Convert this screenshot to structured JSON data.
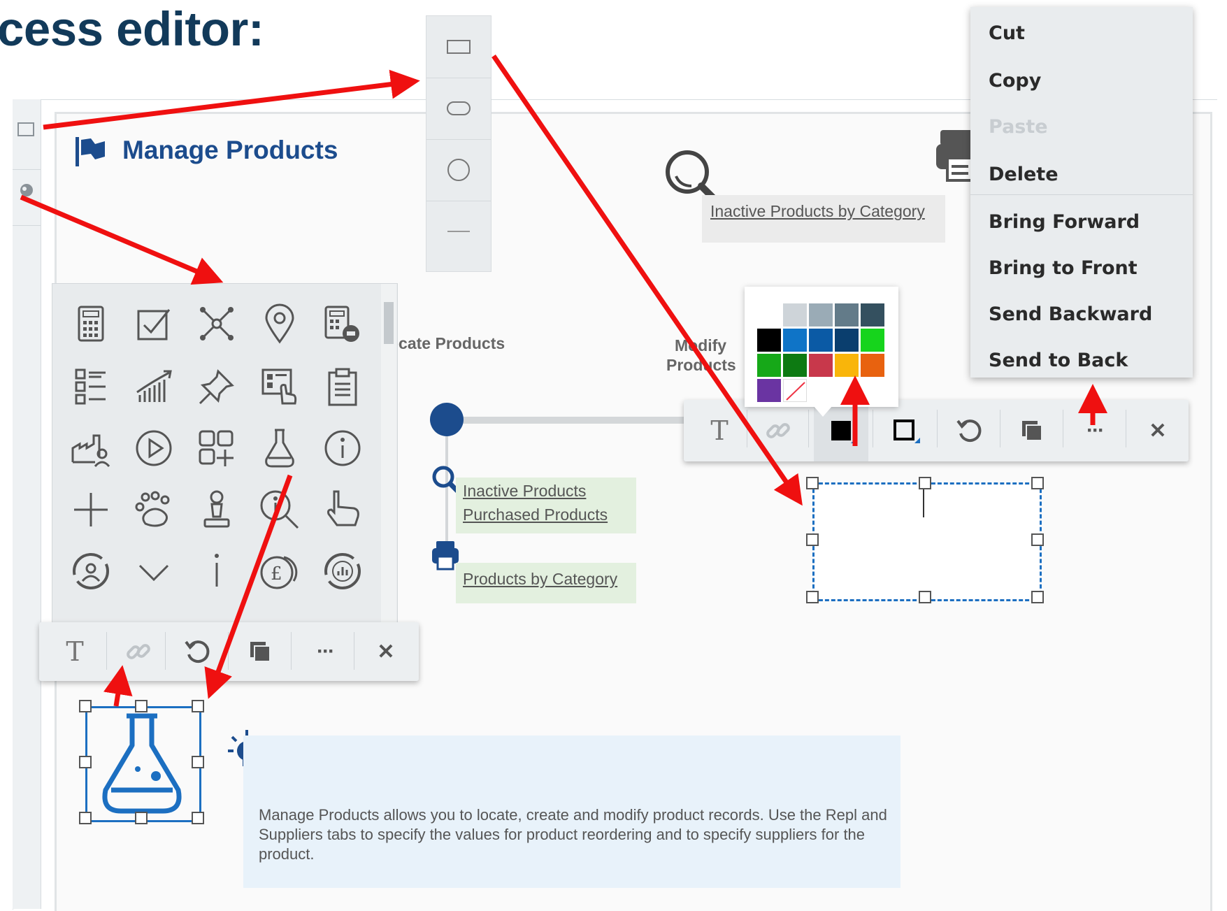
{
  "heading": "cess editor:",
  "page_title": "Manage Products",
  "canvas": {
    "locate_label": "ocate Products",
    "modify_label_line1": "Modify",
    "modify_label_line2": "Products",
    "inactive_by_category": "Inactive Products by Category",
    "inactive_products": "Inactive Products",
    "purchased_products": "Purchased Products",
    "products_by_category": "Products by Category",
    "description": "Manage Products allows you to locate, create and modify product records. Use the Repl and Suppliers tabs to specify the values for product reordering and to specify suppliers for the product."
  },
  "context_menu": {
    "items": [
      "Cut",
      "Copy",
      "Paste",
      "Delete",
      "Bring Forward",
      "Bring to Front",
      "Send Backward",
      "Send to Back"
    ],
    "disabled": [
      "Paste"
    ]
  },
  "toolbar": {
    "text_label": "T",
    "more_label": "···",
    "close_label": "✕"
  },
  "colors": {
    "swatches": [
      "#ffffff",
      "#ced4d9",
      "#9aabb6",
      "#637b89",
      "#34505f",
      "#000000",
      "#0f74c7",
      "#0b5aa5",
      "#0a3e6e",
      "#16d41c",
      "#16a818",
      "#0d7a12",
      "#c8384b",
      "#f9b50a",
      "#e8620f",
      "#6a34a2",
      "none"
    ],
    "title_color": "#123a5a",
    "accent_blue": "#1c4c8d",
    "arrow_red": "#ef1010"
  },
  "icons": [
    "calculator-icon",
    "checkbox-icon",
    "network-icon",
    "location-pin-icon",
    "calculator-chat-icon",
    "checklist-icon",
    "growth-chart-icon",
    "pushpin-icon",
    "form-touch-icon",
    "clipboard-icon",
    "factory-user-icon",
    "play-icon",
    "add-grid-icon",
    "flask-icon",
    "info-circle-icon",
    "plus-icon",
    "paw-icon",
    "chess-pawn-icon",
    "info-search-icon",
    "pointing-hand-icon",
    "user-cycle-icon",
    "chevron-down-icon",
    "info-i-icon",
    "pound-coins-icon",
    "chart-cycle-icon"
  ]
}
